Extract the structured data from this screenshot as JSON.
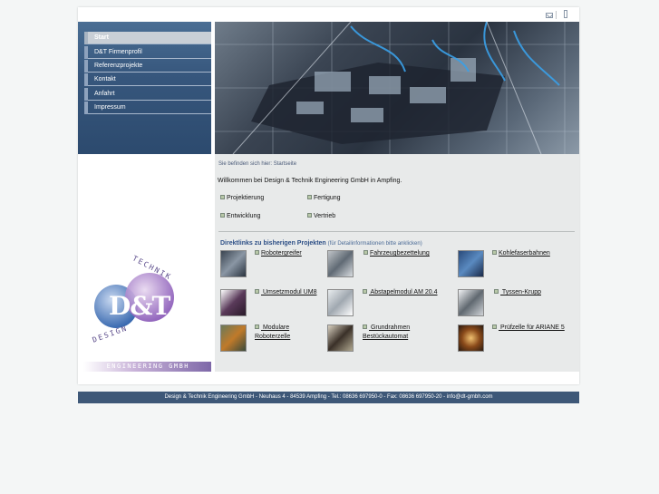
{
  "top_icons": [
    "mail-icon",
    "print-icon"
  ],
  "nav": {
    "items": [
      {
        "label": "Start",
        "active": true
      },
      {
        "label": "D&T Firmenprofil",
        "active": false
      },
      {
        "label": "Referenzprojekte",
        "active": false
      },
      {
        "label": "Kontakt",
        "active": false
      },
      {
        "label": "Anfahrt",
        "active": false
      },
      {
        "label": "Impressum",
        "active": false
      }
    ]
  },
  "logo": {
    "text_main": "D&T",
    "text_arc_top": "TECHNIK",
    "text_arc_bottom": "DESIGN",
    "bar": "ENGINEERING GMBH"
  },
  "breadcrumb": "Sie befinden sich hier: Startseite",
  "welcome": "Willkommen bei Design & Technik Engineering GmbH in Ampfing.",
  "services": [
    "Projektierung",
    "Fertigung",
    "Entwicklung",
    "Vertrieb"
  ],
  "direktlinks": {
    "title": "Direktlinks zu bisherigen Projekten",
    "hint": "(für Detailinformationen bitte anklicken)",
    "projects": [
      {
        "label": "Robotergreifer"
      },
      {
        "label": "Fahrzeugbezettelung"
      },
      {
        "label": "Kohlefaserbahnen"
      },
      {
        "label": " Umsetzmodul UM8"
      },
      {
        "label": " Abstapelmodul AM 20.4"
      },
      {
        "label": " Tyssen-Krupp"
      },
      {
        "label": " Modulare Roboterzelle"
      },
      {
        "label": " Grundrahmen Bestückautomat"
      },
      {
        "label": " Prüfzelle für ARIANE 5"
      }
    ]
  },
  "footer": "Design & Technik Engineering GmbH - Neuhaus 4 - 84539 Ampfing - Tel.: 08636 697950-0 - Fax: 08636 697950-20 - info@dt-gmbh.com",
  "colors": {
    "nav_bg": "#37577d",
    "footer_bg": "#3e5878",
    "link_blue": "#2d4f86",
    "content_bg": "#e8eaea"
  }
}
